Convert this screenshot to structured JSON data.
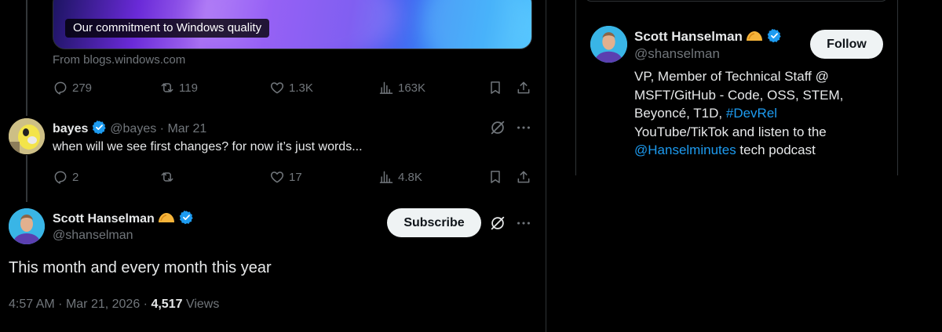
{
  "card": {
    "badge": "Our commitment to Windows quality",
    "source": "From blogs.windows.com"
  },
  "tweet1_actions": {
    "replies": "279",
    "retweets": "119",
    "likes": "1.3K",
    "views": "163K"
  },
  "reply": {
    "name": "bayes",
    "handle": "@bayes",
    "date": "Mar 21",
    "text": "when will we see first changes? for now it’s just words...",
    "replies": "2",
    "likes": "17",
    "views": "4.8K"
  },
  "main_tweet": {
    "name": "Scott Hanselman",
    "handle": "@shanselman",
    "subscribe_label": "Subscribe",
    "text": "This month and every month this year",
    "time": "4:57 AM",
    "date": "Mar 21, 2026",
    "views_count": "4,517",
    "views_label": "Views"
  },
  "profile_card": {
    "name": "Scott Hanselman",
    "handle": "@shanselman",
    "follow_label": "Follow",
    "bio_line1": "VP, Member of Technical Staff @",
    "bio_line2": "MSFT/GitHub - Code, OSS, STEM,",
    "bio_line3a": "Beyoncé, T1D, ",
    "bio_hashtag": "#DevRel",
    "bio_line4": "YouTube/TikTok and listen to the",
    "bio_mention": "@Hanselminutes",
    "bio_line5b": " tech podcast"
  },
  "colors": {
    "accent": "#1d9bf0",
    "muted": "#71767b",
    "text": "#e7e9ea",
    "border": "#2f3336"
  },
  "icons": [
    "reply-icon",
    "retweet-icon",
    "like-icon",
    "views-icon",
    "bookmark-icon",
    "share-icon",
    "grok-icon",
    "more-icon",
    "verified-icon",
    "taco-emoji"
  ]
}
